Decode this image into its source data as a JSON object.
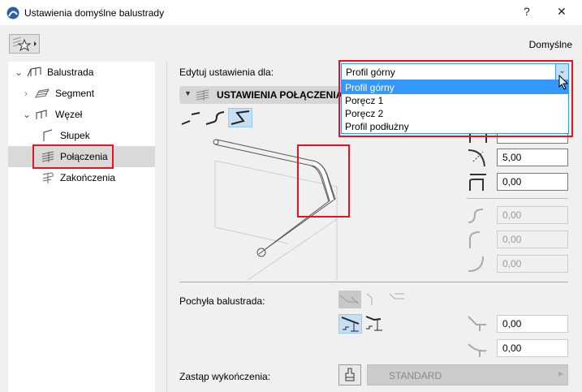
{
  "window": {
    "title": "Ustawienia domyślne balustrady",
    "help": "?",
    "close": "✕"
  },
  "toolbar": {
    "preset_label": "Domyślne"
  },
  "tree": {
    "items": [
      {
        "label": "Balustrada",
        "expanded": true
      },
      {
        "label": "Segment",
        "expanded": false
      },
      {
        "label": "Węzeł",
        "expanded": true
      },
      {
        "label": "Słupek"
      },
      {
        "label": "Połączenia",
        "selected": true
      },
      {
        "label": "Zakończenia"
      }
    ]
  },
  "main": {
    "edit_for_label": "Edytuj ustawienia dla:",
    "edit_for_value": "Profil górny",
    "dropdown_options": [
      "Profil górny",
      "Poręcz 1",
      "Poręcz 2",
      "Profil podłużny"
    ],
    "section_title": "USTAWIENIA POŁĄCZENIA PR",
    "fields": {
      "radius": "5,00",
      "offset": "0,00",
      "d1": "0,00",
      "d2": "0,00",
      "d3": "0,00"
    },
    "sloped_label": "Pochyła balustrada:",
    "sloped_fields": [
      "0,00",
      "0,00"
    ],
    "override_label": "Zastąp wykończenia:",
    "override_value": "STANDARD"
  },
  "colors": {
    "accent": "#3399ff",
    "selected_btn": "#c5dff5",
    "highlight": "#e81123"
  }
}
